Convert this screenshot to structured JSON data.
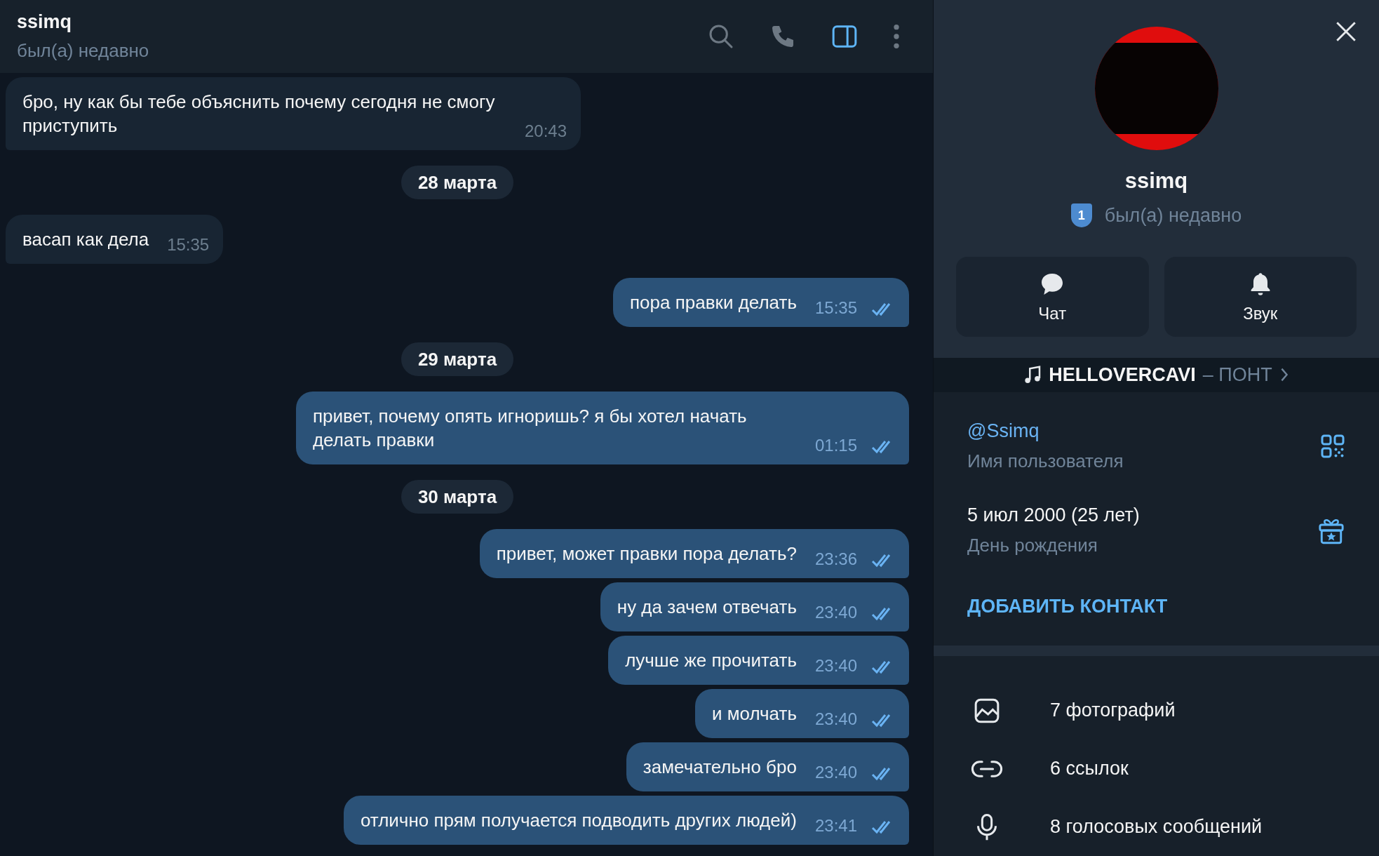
{
  "header": {
    "title": "ssimq",
    "status": "был(а) недавно",
    "panel_open": true
  },
  "messages": [
    {
      "kind": "incoming",
      "text": "бро, ну как бы тебе объяснить почему сегодня не смогу приступить",
      "time": "20:43"
    },
    {
      "kind": "date",
      "text": "28 марта"
    },
    {
      "kind": "incoming",
      "text": "васап как дела",
      "time": "15:35"
    },
    {
      "kind": "outgoing",
      "text": "пора правки делать",
      "time": "15:35",
      "read": true
    },
    {
      "kind": "date",
      "text": "29 марта"
    },
    {
      "kind": "outgoing",
      "text": "привет, почему опять игноришь? я бы хотел начать делать правки",
      "time": "01:15",
      "read": true
    },
    {
      "kind": "date",
      "text": "30 марта"
    },
    {
      "kind": "outgoing",
      "text": "привет, может правки пора делать?",
      "time": "23:36",
      "read": true
    },
    {
      "kind": "outgoing",
      "text": "ну да зачем отвечать",
      "time": "23:40",
      "read": true
    },
    {
      "kind": "outgoing",
      "text": "лучше же прочитать",
      "time": "23:40",
      "read": true
    },
    {
      "kind": "outgoing",
      "text": "и молчать",
      "time": "23:40",
      "read": true
    },
    {
      "kind": "outgoing",
      "text": "замечательно бро",
      "time": "23:40",
      "read": true
    },
    {
      "kind": "outgoing",
      "text": "отлично прям получается подводить других людей)",
      "time": "23:41",
      "read": true
    }
  ],
  "profile": {
    "name": "ssimq",
    "badge": "1",
    "status": "был(а) недавно",
    "actions": [
      {
        "kind": "chat",
        "label": "Чат"
      },
      {
        "kind": "sound",
        "label": "Звук"
      }
    ],
    "music": {
      "artist": "HELLOVERCAVI",
      "title": "– ПОНТ"
    },
    "info": [
      {
        "kind": "username",
        "value": "@Ssimq",
        "label": "Имя пользователя"
      },
      {
        "kind": "birthday",
        "value": "5 июл 2000 (25 лет)",
        "label": "День рождения"
      }
    ],
    "add_contact": "ДОБАВИТЬ КОНТАКТ",
    "media": [
      {
        "kind": "photos",
        "text": "7 фотографий"
      },
      {
        "kind": "links",
        "text": "6 ссылок"
      },
      {
        "kind": "voice",
        "text": "8 голосовых сообщений"
      }
    ]
  }
}
